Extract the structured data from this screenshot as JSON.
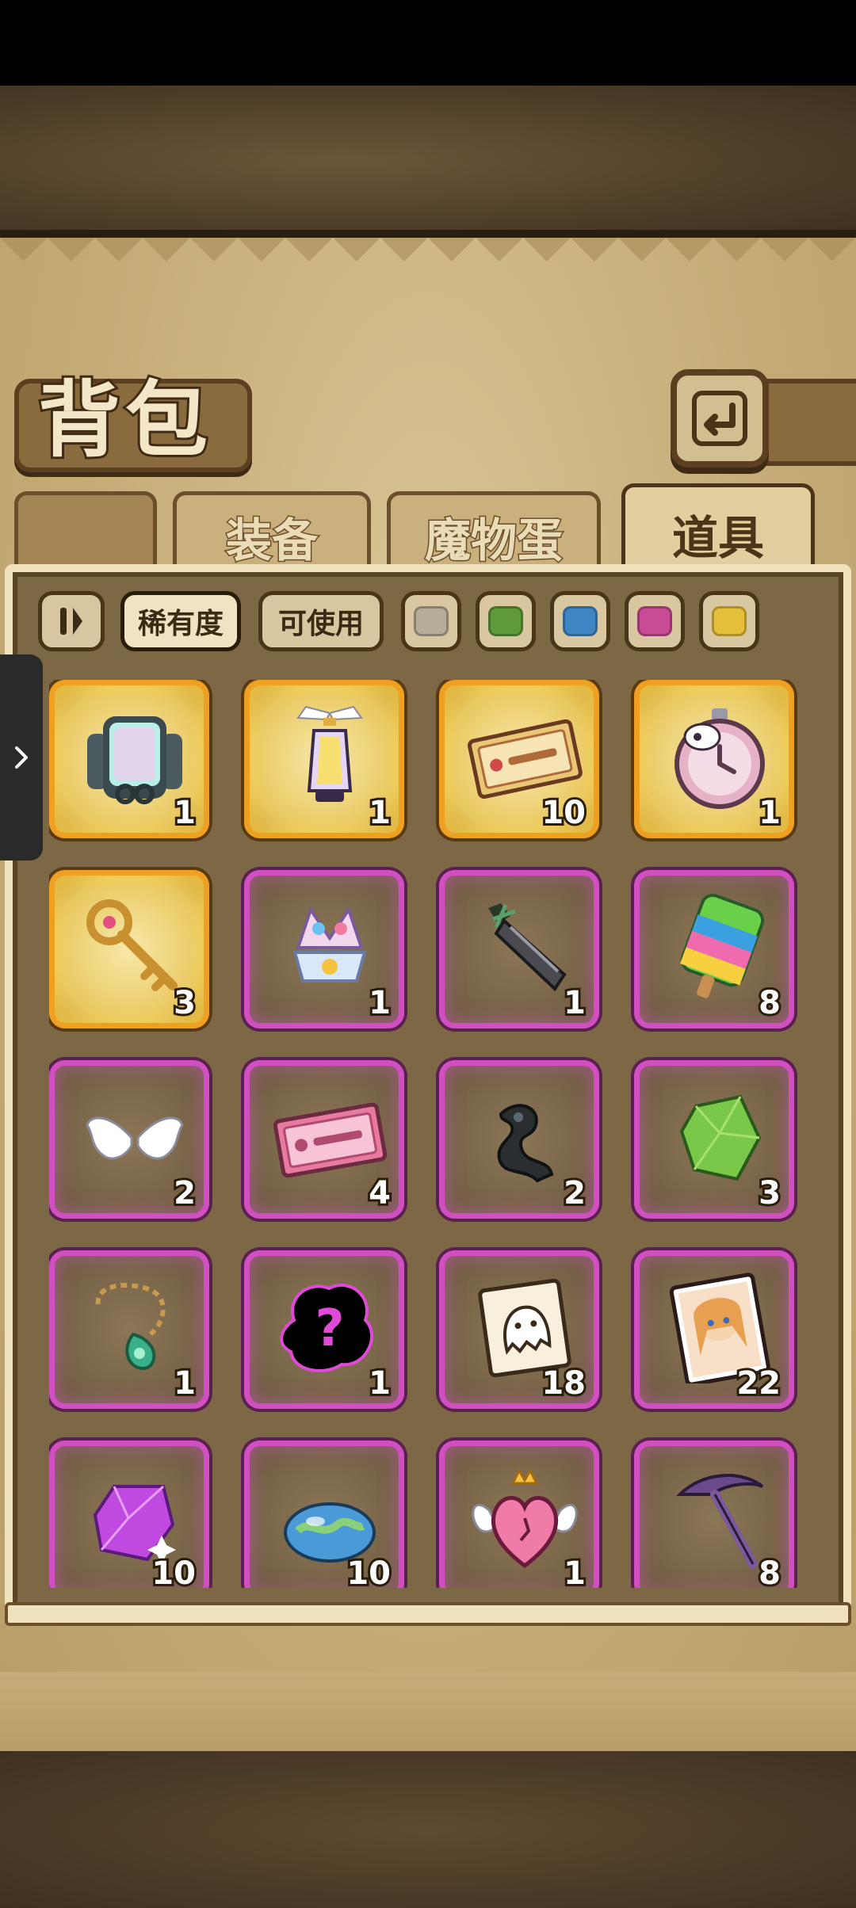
{
  "header": {
    "title": "背包",
    "back_icon": "return-arrow-icon"
  },
  "tabs": [
    {
      "label": "装备",
      "active": false
    },
    {
      "label": "魔物蛋",
      "active": false
    },
    {
      "label": "道具",
      "active": true
    }
  ],
  "filters": {
    "sort_icon": "sort-toggle-icon",
    "rarity_label": "稀有度",
    "usable_label": "可使用",
    "colors": [
      "#b6ad98",
      "#5e9a3a",
      "#3f86c4",
      "#c94b96",
      "#e6bf3a"
    ]
  },
  "items": [
    {
      "icon": "rainbow-mirror-backpack-icon",
      "count": "1",
      "rarity": "legendary"
    },
    {
      "icon": "winged-lantern-icon",
      "count": "1",
      "rarity": "legendary"
    },
    {
      "icon": "gold-ticket-icon",
      "count": "10",
      "rarity": "legendary"
    },
    {
      "icon": "cow-stopwatch-icon",
      "count": "1",
      "rarity": "legendary"
    },
    {
      "icon": "gold-key-icon",
      "count": "3",
      "rarity": "legendary"
    },
    {
      "icon": "crystal-crown-icon",
      "count": "1",
      "rarity": "epic"
    },
    {
      "icon": "dark-greatsword-icon",
      "count": "1",
      "rarity": "epic"
    },
    {
      "icon": "rainbow-popsicle-icon",
      "count": "8",
      "rarity": "epic"
    },
    {
      "icon": "white-wings-icon",
      "count": "2",
      "rarity": "epic"
    },
    {
      "icon": "pink-ticket-icon",
      "count": "4",
      "rarity": "epic"
    },
    {
      "icon": "dark-scroll-icon",
      "count": "2",
      "rarity": "epic"
    },
    {
      "icon": "green-gem-icon",
      "count": "3",
      "rarity": "epic"
    },
    {
      "icon": "jade-necklace-icon",
      "count": "1",
      "rarity": "epic"
    },
    {
      "icon": "mystery-silhouette-icon",
      "count": "1",
      "rarity": "epic"
    },
    {
      "icon": "ghost-card-icon",
      "count": "18",
      "rarity": "epic"
    },
    {
      "icon": "character-card-icon",
      "count": "22",
      "rarity": "epic"
    },
    {
      "icon": "purple-crystal-icon",
      "count": "10",
      "rarity": "epic"
    },
    {
      "icon": "planet-slime-icon",
      "count": "10",
      "rarity": "epic"
    },
    {
      "icon": "winged-heart-icon",
      "count": "1",
      "rarity": "epic"
    },
    {
      "icon": "pickaxe-icon",
      "count": "8",
      "rarity": "epic"
    }
  ],
  "drawer": {
    "icon": "chevron-right-icon"
  }
}
